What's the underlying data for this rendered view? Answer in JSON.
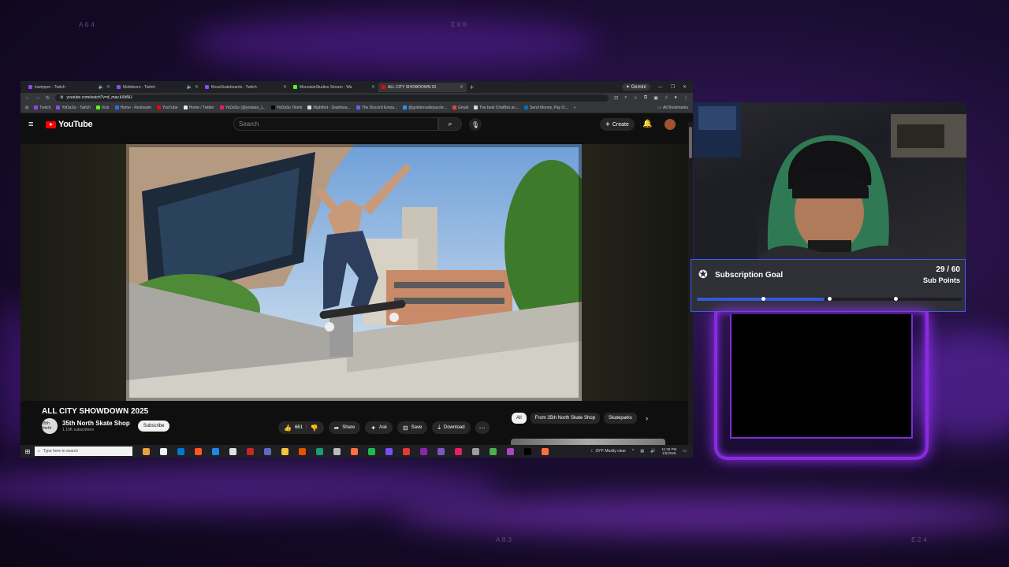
{
  "overlay": {
    "codes": [
      "A64",
      "E80",
      "A83",
      "E24"
    ]
  },
  "browser": {
    "tabs": [
      {
        "label": "lowripper - Twitch",
        "color": "#9146ff",
        "active": false
      },
      {
        "label": "Mattdoore - Twitch",
        "color": "#9146ff",
        "active": false
      },
      {
        "label": "BossSkateboards - Twitch",
        "color": "#9146ff",
        "active": false
      },
      {
        "label": "MountainStudios Stream - Wa",
        "color": "#53fc18",
        "active": false
      },
      {
        "label": "ALL CITY SHOWDOWN 20",
        "color": "#ff0000",
        "active": true
      }
    ],
    "tab_right": {
      "gemini": "Gemini"
    },
    "url": "youtube.com/watch?v=d_mav.kXbNU",
    "bookmarks": [
      "Twitch",
      "YoDaSo - Twitch",
      "Kick",
      "Home - Restream",
      "YouTube",
      "Home / Twitter",
      "YoDaSo (@yodaso_)...",
      "YoDaSo Tiktok",
      "Nightbot - Dashboa...",
      "The Discord Emoa...",
      "@goldenvalleyaccle...",
      "Gmail",
      "The best ChatBot an...",
      "Send Money, Pay O..."
    ],
    "all_bookmarks": "All Bookmarks"
  },
  "youtube": {
    "logo_text": "YouTube",
    "search_placeholder": "Search",
    "create_label": "Create",
    "video": {
      "title": "ALL CITY SHOWDOWN 2025",
      "channel": "35th North Skate Shop",
      "subscribers": "1.15K subscribers",
      "avatar_text": "35th North",
      "subscribe_label": "Subscribe",
      "likes": "661",
      "share_label": "Share",
      "ask_label": "Ask",
      "save_label": "Save",
      "download_label": "Download"
    },
    "chips": [
      "All",
      "From 35th North Skate Shop",
      "Skateparks"
    ]
  },
  "taskbar": {
    "search_placeholder": "Type here to search",
    "weather": "29°F  Mostly clear",
    "time": "11:38 PM",
    "date": "1/5/2026",
    "apps": [
      "#e8a33d",
      "#f2f2f2",
      "#0078d4",
      "#ff5722",
      "#1e88e5",
      "#e0e0e0",
      "#c62828",
      "#5c6bc0",
      "#f6c343",
      "#e65100",
      "#1b9e77",
      "#bbbbbb",
      "#ff7043",
      "#1db954",
      "#7c4dff",
      "#e53935",
      "#8e24aa",
      "#7e57c2",
      "#e91e63",
      "#9e9e9e",
      "#4caf50",
      "#ab47bc",
      "#000000",
      "#ff6e40"
    ]
  },
  "sub_goal": {
    "title": "Subscription Goal",
    "count": "29 / 60",
    "unit": "Sub Points",
    "current": 29,
    "target": 60,
    "markers": [
      0.25,
      0.5,
      0.75
    ]
  }
}
